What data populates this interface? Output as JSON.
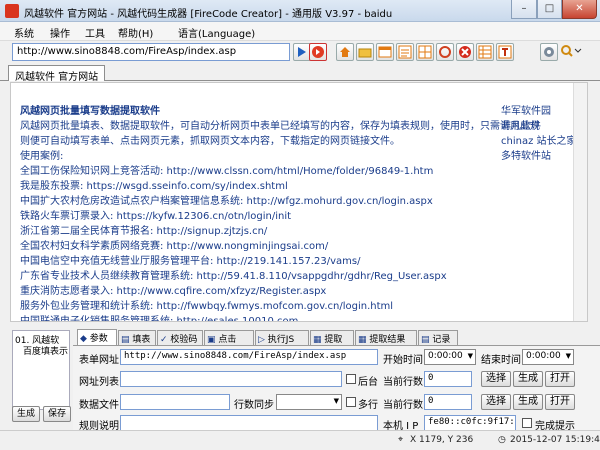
{
  "window": {
    "title": "风越软件 官方网站 - 风越代码生成器 [FireCode Creator] - 通用版 V3.97 - baidu",
    "controls": {
      "minimize": "–",
      "maximize": "□",
      "close": "✕"
    }
  },
  "menu": [
    "系统",
    "操作",
    "工具",
    "帮助(H)",
    "语言(Language)"
  ],
  "toolbar": {
    "url": "http://www.sino8848.com/FireAsp/index.asp",
    "icons": [
      "go-arrow-icon",
      "back-red-icon",
      "home-icon",
      "folder-icon",
      "window-icon",
      "list-icon",
      "grid-icon",
      "refresh-icon",
      "stop-icon",
      "table-icon",
      "text-icon",
      "settings-icon",
      "zoom-icon"
    ]
  },
  "browser_tab": "风越软件 官方网站",
  "content": {
    "title": "风越网页批量填写数据提取软件",
    "intro": [
      "风越网页批量填表、数据提取软件，可自动分析网页中表单已经填写的内容，保存为填表规则，使用时，只需调用此规",
      "则便可自动填写表单、点击网页元素，抓取网页文本内容，下载指定的网页链接文件。"
    ],
    "case_label": "使用案例:",
    "cases": [
      "全国工伤保险知识网上竞答活动: http://www.clssn.com/html/Home/folder/96849-1.htm",
      "我是股东投票: https://wsgd.sseinfo.com/sy/index.shtml",
      "中国扩大农村危房改造试点农户档案管理信息系统: http://wfgz.mohurd.gov.cn/login.aspx",
      "铁路火车票订票录入: https://kyfw.12306.cn/otn/login/init",
      "浙江省第二届全民体育节报名: http://signup.zjtzjs.cn/",
      "全国农村妇女科学素质网络竞赛: http://www.nongminjingsai.com/",
      "中国电信空中充值无线营业厅服务管理平台: http://219.141.157.23/vams/",
      "广东省专业技术人员继续教育管理系统: http://59.41.8.110/vsappgdhr/gdhr/Reg_User.aspx",
      "重庆消防志愿者录入: http://www.cqfire.com/xfzyz/Register.aspx",
      "服务外包业务管理和统计系统: http://fwwbqy.fwmys.mofcom.gov.cn/login.html",
      "中国联通电子化销售服务管理系统: http://esales.10010.com"
    ],
    "side_links": [
      "华军软件园",
      "非凡软件",
      "chinaz 站长之家",
      "多特软件站"
    ]
  },
  "left_panel": {
    "tree": [
      "01. 风越软",
      "百度填表示"
    ],
    "buttons": [
      "生成",
      "保存"
    ]
  },
  "panel_tabs": [
    "参数",
    "填表",
    "校验码",
    "点击",
    "执行JS",
    "提取",
    "提取结果",
    "记录"
  ],
  "params": {
    "form_url_label": "表单网址",
    "form_url_value": "http://www.sino8848.com/FireAsp/index.asp",
    "start_time_label": "开始时间",
    "start_time_value": "0:00:00",
    "end_time_label": "结束时间",
    "end_time_value": "0:00:00",
    "url_list_label": "网址列表",
    "background_label": "后台",
    "current_line_label": "当前行数",
    "current_line_value": "0",
    "data_file_label": "数据文件",
    "line_sync_label": "行数同步",
    "multi_line_label": "多行",
    "rule_desc_label": "规则说明",
    "local_ip_label": "本机 I P",
    "local_ip_value": "fe80::c0fc:9f17:b",
    "complete_label": "完成提示",
    "buttons": {
      "select": "选择",
      "generate": "生成",
      "open": "打开"
    }
  },
  "status": {
    "coords": "X 1179, Y 236",
    "datetime": "2015-12-07 15:19:49"
  }
}
